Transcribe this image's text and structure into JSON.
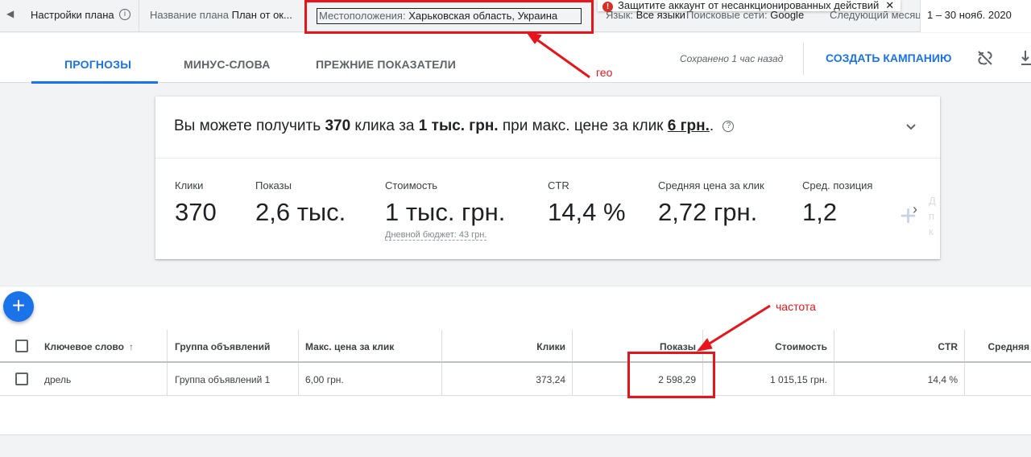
{
  "topbar": {
    "settings_label": "Настройки плана",
    "plan_name_key": "Название плана",
    "plan_name_value": "План от ок...",
    "location_key": "Местоположения:",
    "location_value": "Харьковская область, Украина",
    "language_key": "Язык:",
    "language_value": "Все языки",
    "network_key": "Поисковые сети:",
    "network_value": "Google",
    "next_month_label": "Следующий месяц",
    "date_range": "1 – 30 нояб. 2020",
    "toast_text": "Защитите аккаунт от несанкционированных действий"
  },
  "tabs": {
    "forecasts": "ПРОГНОЗЫ",
    "negative_keywords": "МИНУС-СЛОВА",
    "historical_metrics": "ПРЕЖНИЕ ПОКАЗАТЕЛИ",
    "saved_status": "Сохранено 1 час назад",
    "create_campaign": "СОЗДАТЬ КАМПАНИЮ"
  },
  "summary": {
    "prefix": "Вы можете получить",
    "clicks": "370",
    "clicks_word": "клика за",
    "cost": "1 тыс. грн.",
    "middle": "при макс. цене за клик",
    "max_cpc": "6 грн.",
    "suffix": "."
  },
  "metrics": [
    {
      "label": "Клики",
      "value": "370"
    },
    {
      "label": "Показы",
      "value": "2,6 тыс."
    },
    {
      "label": "Стоимость",
      "value": "1 тыс. грн.",
      "sub": "Дневной бюджет: 43 грн."
    },
    {
      "label": "CTR",
      "value": "14,4 %"
    },
    {
      "label": "Средняя цена за клик",
      "value": "2,72 грн."
    },
    {
      "label": "Сред. позиция",
      "value": "1,2"
    }
  ],
  "add_column_text": "Д п к",
  "table": {
    "headers": {
      "keyword": "Ключевое слово",
      "ad_group": "Группа объявлений",
      "max_cpc": "Макс. цена за клик",
      "clicks": "Клики",
      "impressions": "Показы",
      "cost": "Стоимость",
      "ctr": "CTR",
      "avg": "Средняя"
    },
    "rows": [
      {
        "keyword": "дрель",
        "ad_group": "Группа объявлений 1",
        "max_cpc": "6,00 грн.",
        "clicks": "373,24",
        "impressions": "2 598,29",
        "cost": "1 015,15 грн.",
        "ctr": "14,4 %"
      }
    ]
  },
  "annotations": {
    "geo": "гео",
    "frequency": "частота",
    "color": "#e8141c"
  },
  "colors": {
    "accent": "#1a73e8",
    "annotation_red": "#e8141c"
  }
}
